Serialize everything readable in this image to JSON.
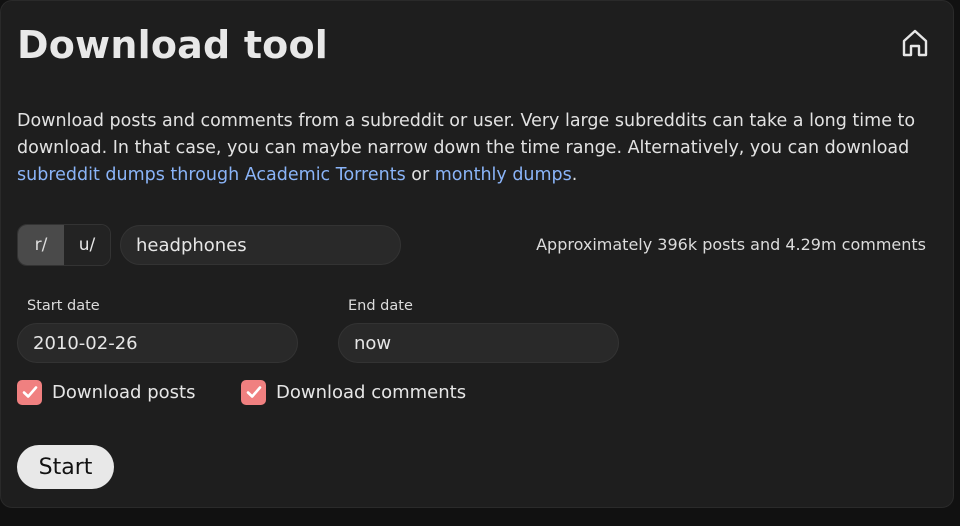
{
  "page": {
    "title": "Download tool"
  },
  "description": {
    "text_before": "Download posts and comments from a subreddit or user. Very large subreddits can take a long time to download. In that case, you can maybe narrow down the time range. Alternatively, you can download ",
    "link1": "subreddit dumps through Academic Torrents",
    "text_between": " or ",
    "link2": "monthly dumps",
    "text_after": "."
  },
  "source": {
    "subreddit_label": "r/",
    "user_label": "u/",
    "selected": "r/",
    "name_value": "headphones"
  },
  "estimate": "Approximately 396k posts and 4.29m comments",
  "dates": {
    "start_label": "Start date",
    "start_value": "2010-02-26",
    "end_label": "End date",
    "end_value": "now"
  },
  "options": {
    "posts_label": "Download posts",
    "posts_checked": true,
    "comments_label": "Download comments",
    "comments_checked": true
  },
  "actions": {
    "start_label": "Start"
  },
  "colors": {
    "accent_checkbox": "#f08080",
    "link": "#8ab4f8",
    "background": "#1e1e1e"
  },
  "icons": {
    "home": "home-icon",
    "check": "checkmark-icon"
  }
}
